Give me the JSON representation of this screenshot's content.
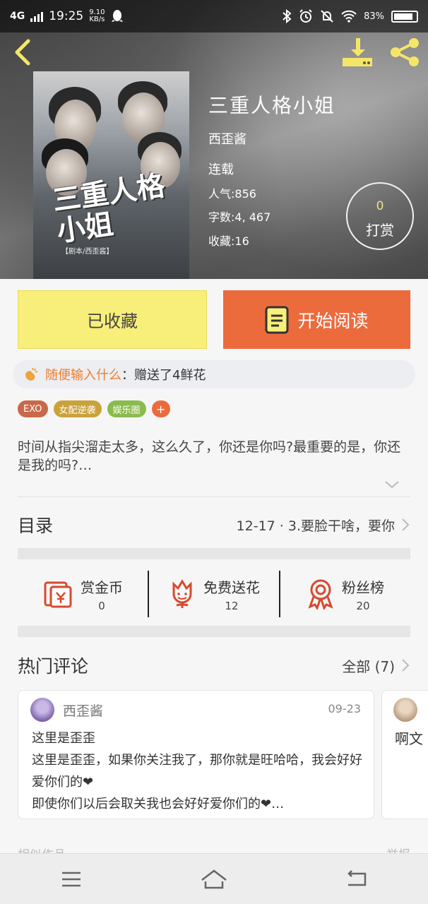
{
  "status_bar": {
    "network": "4G",
    "time": "19:25",
    "speed_value": "9.10",
    "speed_unit": "KB/s",
    "battery": "83%"
  },
  "book": {
    "title": "三重人格小姐",
    "author": "西歪酱",
    "status": "连载",
    "popularity": "人气:856",
    "word_count": "字数:4, 467",
    "favorites": "收藏:16",
    "cover_title": "三重人格小姐",
    "cover_credit": "【剧本/西歪酱】"
  },
  "tip": {
    "count": "0",
    "label": "打赏"
  },
  "actions": {
    "favorited_label": "已收藏",
    "start_reading_label": "开始阅读"
  },
  "gift_bar": {
    "user": "随便输入什么",
    "separator": "：",
    "text": "赠送了4鲜花"
  },
  "tags": [
    {
      "label": "EXO",
      "color": "#c9684a"
    },
    {
      "label": "女配逆袭",
      "color": "#c9a23a"
    },
    {
      "label": "娱乐圈",
      "color": "#8bbb4e"
    },
    {
      "label": "+",
      "color": "#ec6b3d"
    }
  ],
  "description": "时间从指尖溜走太多，这么久了，你还是你吗?最重要的是，你还是我的吗?…",
  "toc": {
    "label": "目录",
    "latest": "12-17  ·  3.要脸干啥，要你"
  },
  "stats": [
    {
      "label": "赏金币",
      "value": "0",
      "icon": "coin-envelope-icon"
    },
    {
      "label": "免费送花",
      "value": "12",
      "icon": "flower-icon"
    },
    {
      "label": "粉丝榜",
      "value": "20",
      "icon": "medal-icon"
    }
  ],
  "comments_section": {
    "title": "热门评论",
    "all_label": "全部 (7)"
  },
  "comments": [
    {
      "user": "西歪酱",
      "date": "09-23",
      "lines": [
        "这里是歪歪",
        "这里是歪歪，如果你关注我了，那你就是旺哈哈，我会好好爱你们的❤",
        "即使你们以后会取关我也会好好爱你们的❤…"
      ]
    },
    {
      "partial_text": "啊文"
    }
  ],
  "faded_sections": {
    "left": "相似作品",
    "right": "举报"
  },
  "colors": {
    "accent_orange": "#ec6b3d",
    "favorite_yellow": "#f8ef7a",
    "icon_yellow": "#f5e66a",
    "gift_user": "#ef7d2a",
    "stat_icon_red": "#d64a2e"
  }
}
